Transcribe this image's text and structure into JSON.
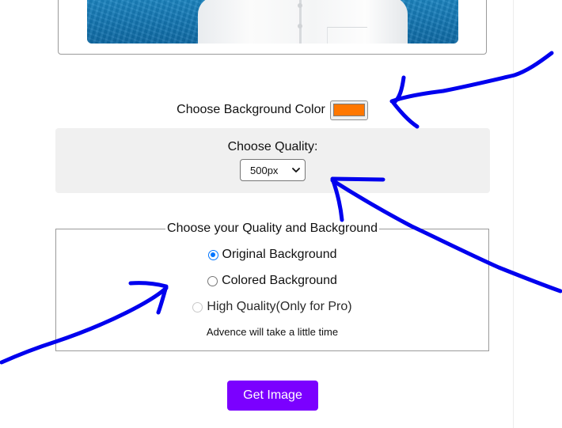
{
  "background_color": {
    "label": "Choose Background Color",
    "value": "#ff7700"
  },
  "quality": {
    "label": "Choose Quality:",
    "selected": "500px"
  },
  "options": {
    "legend": "Choose your Quality and Background",
    "radios": [
      {
        "label": "Original Background",
        "checked": true,
        "disabled": false
      },
      {
        "label": "Colored Background",
        "checked": false,
        "disabled": false
      },
      {
        "label": "High Quality(Only for Pro)",
        "checked": false,
        "disabled": true
      }
    ],
    "note": "Advence will take a little time"
  },
  "get_image_button": {
    "label": "Get Image",
    "color": "#7b00ff"
  },
  "colors": {
    "annotation_ink": "#0000ee",
    "panel_bg": "#f0f0f0",
    "radio_accent": "#0075ff"
  },
  "icons": {
    "select": "chevron-down-icon"
  }
}
